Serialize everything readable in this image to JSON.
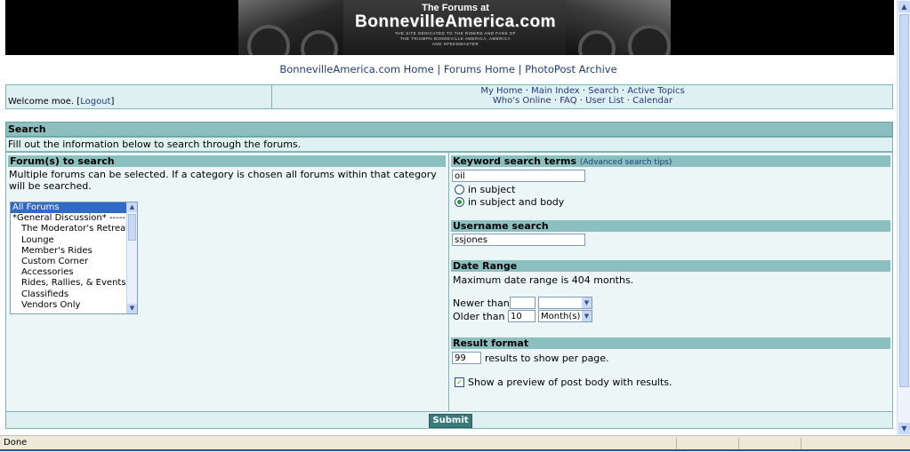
{
  "banner": {
    "line1": "The Forums at",
    "line2": "BonnevilleAmerica.com",
    "line3": "THE SITE DEDICATED TO THE RIDERS AND FANS OF",
    "line4": "THE TRIUMPH BONNEVILLE AMERICA, AMERICA",
    "line5": "AND SPEEDMASTER"
  },
  "topnav": {
    "home": "BonnevilleAmerica.com Home",
    "sep": "|",
    "forums": "Forums Home",
    "archive": "PhotoPost Archive"
  },
  "welcome": {
    "text": "Welcome moe. [",
    "logout": "Logout",
    "close": "]",
    "links_row1": [
      "My Home",
      "Main Index",
      "Search",
      "Active Topics"
    ],
    "links_row2": [
      "Who's Online",
      "FAQ",
      "User List",
      "Calendar"
    ],
    "dot": " · "
  },
  "search": {
    "title": "Search",
    "instructions": "Fill out the information below to search through the forums.",
    "forums_header": "Forum(s) to search",
    "forums_help": "Multiple forums can be selected. If a category is chosen all forums within that category will be searched.",
    "forum_options": [
      {
        "label": "All Forums",
        "selected": true,
        "indent": false
      },
      {
        "label": "*General Discussion* -----",
        "selected": false,
        "indent": false
      },
      {
        "label": "The Moderator's Retreat",
        "selected": false,
        "indent": true
      },
      {
        "label": "Lounge",
        "selected": false,
        "indent": true
      },
      {
        "label": "Member's Rides",
        "selected": false,
        "indent": true
      },
      {
        "label": "Custom Corner",
        "selected": false,
        "indent": true
      },
      {
        "label": "Accessories",
        "selected": false,
        "indent": true
      },
      {
        "label": "Rides, Rallies, & Events",
        "selected": false,
        "indent": true
      },
      {
        "label": "Classifieds",
        "selected": false,
        "indent": true
      },
      {
        "label": "Vendors Only",
        "selected": false,
        "indent": true
      }
    ],
    "keyword_header": "Keyword search terms",
    "advanced_tips": "(Advanced search tips)",
    "keyword_value": "oil",
    "radio_subject": "in subject",
    "radio_subject_body": "in subject and body",
    "username_header": "Username search",
    "username_value": "ssjones",
    "date_header": "Date Range",
    "date_help": "Maximum date range is 404 months.",
    "newer_label": "Newer than",
    "newer_value": "",
    "newer_unit": "",
    "older_label": "Older than",
    "older_value": "10",
    "older_unit": "Month(s)",
    "result_header": "Result format",
    "per_page_value": "99",
    "per_page_label": "results to show per page.",
    "preview_label": "Show a preview of post body with results.",
    "submit_label": "Submit"
  },
  "status": {
    "text": "Done"
  },
  "colors": {
    "header_bg": "#8cc0c0",
    "row_bg": "#dff0f2",
    "panel_bg": "#ecf6f6",
    "link": "#1e3c78",
    "submit_bg": "#3a7a7a"
  },
  "icons": {
    "scroll_up": "triangle-up",
    "scroll_down": "triangle-down",
    "dropdown": "triangle-down",
    "check": "check-mark"
  }
}
